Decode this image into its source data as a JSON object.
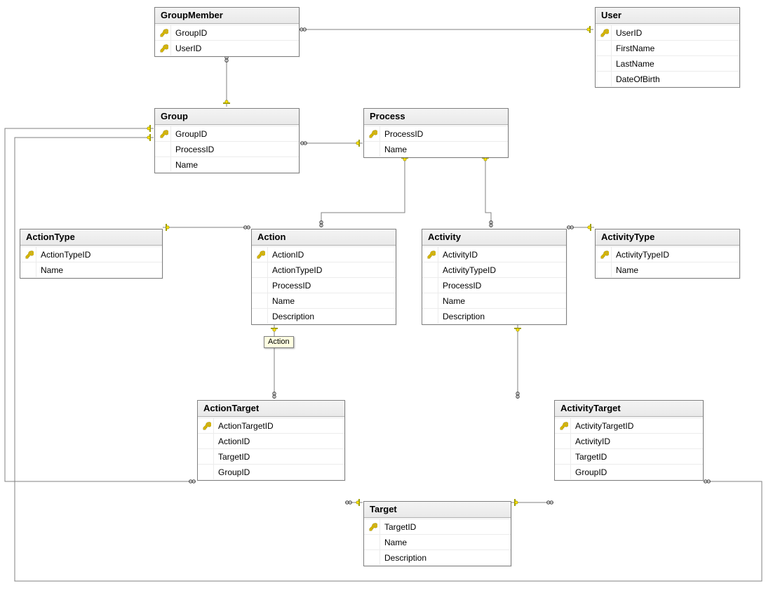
{
  "tooltip": "Action",
  "entities": {
    "groupMember": {
      "title": "GroupMember",
      "fields": [
        {
          "name": "GroupID",
          "pk": true
        },
        {
          "name": "UserID",
          "pk": true
        }
      ]
    },
    "user": {
      "title": "User",
      "fields": [
        {
          "name": "UserID",
          "pk": true
        },
        {
          "name": "FirstName",
          "pk": false
        },
        {
          "name": "LastName",
          "pk": false
        },
        {
          "name": "DateOfBirth",
          "pk": false
        }
      ]
    },
    "group": {
      "title": "Group",
      "fields": [
        {
          "name": "GroupID",
          "pk": true
        },
        {
          "name": "ProcessID",
          "pk": false
        },
        {
          "name": "Name",
          "pk": false
        }
      ]
    },
    "process": {
      "title": "Process",
      "fields": [
        {
          "name": "ProcessID",
          "pk": true
        },
        {
          "name": "Name",
          "pk": false
        }
      ]
    },
    "actionType": {
      "title": "ActionType",
      "fields": [
        {
          "name": "ActionTypeID",
          "pk": true
        },
        {
          "name": "Name",
          "pk": false
        }
      ]
    },
    "action": {
      "title": "Action",
      "fields": [
        {
          "name": "ActionID",
          "pk": true
        },
        {
          "name": "ActionTypeID",
          "pk": false
        },
        {
          "name": "ProcessID",
          "pk": false
        },
        {
          "name": "Name",
          "pk": false
        },
        {
          "name": "Description",
          "pk": false
        }
      ]
    },
    "activity": {
      "title": "Activity",
      "fields": [
        {
          "name": "ActivityID",
          "pk": true
        },
        {
          "name": "ActivityTypeID",
          "pk": false
        },
        {
          "name": "ProcessID",
          "pk": false
        },
        {
          "name": "Name",
          "pk": false
        },
        {
          "name": "Description",
          "pk": false
        }
      ]
    },
    "activityType": {
      "title": "ActivityType",
      "fields": [
        {
          "name": "ActivityTypeID",
          "pk": true
        },
        {
          "name": "Name",
          "pk": false
        }
      ]
    },
    "actionTarget": {
      "title": "ActionTarget",
      "fields": [
        {
          "name": "ActionTargetID",
          "pk": true
        },
        {
          "name": "ActionID",
          "pk": false
        },
        {
          "name": "TargetID",
          "pk": false
        },
        {
          "name": "GroupID",
          "pk": false
        }
      ]
    },
    "target": {
      "title": "Target",
      "fields": [
        {
          "name": "TargetID",
          "pk": true
        },
        {
          "name": "Name",
          "pk": false
        },
        {
          "name": "Description",
          "pk": false
        }
      ]
    },
    "activityTarget": {
      "title": "ActivityTarget",
      "fields": [
        {
          "name": "ActivityTargetID",
          "pk": true
        },
        {
          "name": "ActivityID",
          "pk": false
        },
        {
          "name": "TargetID",
          "pk": false
        },
        {
          "name": "GroupID",
          "pk": false
        }
      ]
    }
  }
}
